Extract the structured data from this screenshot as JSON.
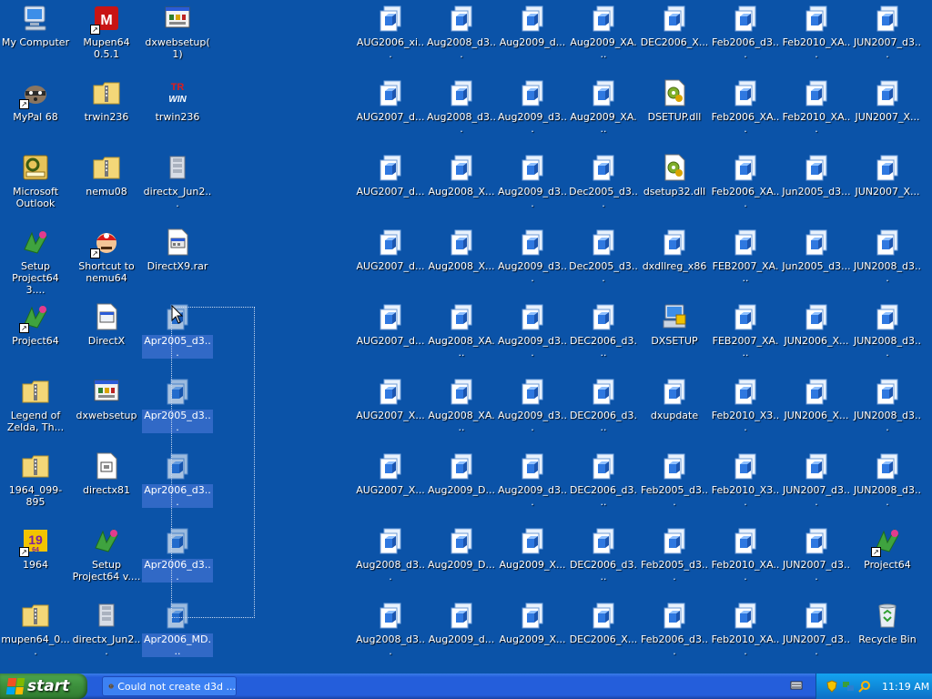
{
  "desktop": {
    "selection_color": "#3169c6",
    "icons": [
      {
        "label": "My Computer",
        "icon": "computer-icon",
        "col": 0,
        "row": 0
      },
      {
        "label": "Mupen64 0.5.1",
        "icon": "mupen64-icon",
        "col": 1,
        "row": 0,
        "shortcut": true
      },
      {
        "label": "dxwebsetup(1)",
        "icon": "installer-icon",
        "col": 2,
        "row": 0
      },
      {
        "label": "MyPal 68",
        "icon": "mypal-icon",
        "col": 0,
        "row": 1,
        "shortcut": true
      },
      {
        "label": "trwin236",
        "icon": "zip-folder-icon",
        "col": 1,
        "row": 1
      },
      {
        "label": "trwin236",
        "icon": "trwin-icon",
        "col": 2,
        "row": 1
      },
      {
        "label": "Microsoft Outlook",
        "icon": "outlook-icon",
        "col": 0,
        "row": 2
      },
      {
        "label": "nemu08",
        "icon": "zip-folder-icon",
        "col": 1,
        "row": 2
      },
      {
        "label": "directx_Jun2...",
        "icon": "archive-icon",
        "col": 2,
        "row": 2
      },
      {
        "label": "Setup Project64 3....",
        "icon": "setup-icon",
        "col": 0,
        "row": 3
      },
      {
        "label": "Shortcut to nemu64",
        "icon": "mario-icon",
        "col": 1,
        "row": 3,
        "shortcut": true
      },
      {
        "label": "DirectX9.rar",
        "icon": "rar-file-icon",
        "col": 2,
        "row": 3
      },
      {
        "label": "Project64",
        "icon": "setup-icon",
        "col": 0,
        "row": 4,
        "shortcut": true
      },
      {
        "label": "DirectX",
        "icon": "window-file-icon",
        "col": 1,
        "row": 4
      },
      {
        "label": "Apr2005_d3...",
        "icon": "cab-icon",
        "col": 2,
        "row": 4,
        "selected": true
      },
      {
        "label": "Legend of Zelda, Th...",
        "icon": "zip-folder-icon",
        "col": 0,
        "row": 5
      },
      {
        "label": "dxwebsetup",
        "icon": "installer-icon",
        "col": 1,
        "row": 5
      },
      {
        "label": "Apr2005_d3...",
        "icon": "cab-icon",
        "col": 2,
        "row": 5,
        "selected": true
      },
      {
        "label": "1964_099-895",
        "icon": "zip-folder-icon",
        "col": 0,
        "row": 6
      },
      {
        "label": "directx81",
        "icon": "doc-icon",
        "col": 1,
        "row": 6
      },
      {
        "label": "Apr2006_d3...",
        "icon": "cab-icon",
        "col": 2,
        "row": 6,
        "selected": true
      },
      {
        "label": "1964",
        "icon": "emu1964-icon",
        "col": 0,
        "row": 7,
        "shortcut": true
      },
      {
        "label": "Setup Project64 v....",
        "icon": "setup-icon",
        "col": 1,
        "row": 7
      },
      {
        "label": "Apr2006_d3...",
        "icon": "cab-icon",
        "col": 2,
        "row": 7,
        "selected": true
      },
      {
        "label": "mupen64_0....",
        "icon": "zip-folder-icon",
        "col": 0,
        "row": 8
      },
      {
        "label": "directx_Jun2...",
        "icon": "archive-icon",
        "col": 1,
        "row": 8
      },
      {
        "label": "Apr2006_MD...",
        "icon": "cab-icon",
        "col": 2,
        "row": 8,
        "selected": true
      },
      {
        "label": "AUG2006_xi...",
        "icon": "cab-icon",
        "col": 5,
        "row": 0
      },
      {
        "label": "AUG2007_d...",
        "icon": "cab-icon",
        "col": 5,
        "row": 1
      },
      {
        "label": "AUG2007_d...",
        "icon": "cab-icon",
        "col": 5,
        "row": 2
      },
      {
        "label": "AUG2007_d...",
        "icon": "cab-icon",
        "col": 5,
        "row": 3
      },
      {
        "label": "AUG2007_d...",
        "icon": "cab-icon",
        "col": 5,
        "row": 4
      },
      {
        "label": "AUG2007_X...",
        "icon": "cab-icon",
        "col": 5,
        "row": 5
      },
      {
        "label": "AUG2007_X...",
        "icon": "cab-icon",
        "col": 5,
        "row": 6
      },
      {
        "label": "Aug2008_d3...",
        "icon": "cab-icon",
        "col": 5,
        "row": 7
      },
      {
        "label": "Aug2008_d3...",
        "icon": "cab-icon",
        "col": 5,
        "row": 8
      },
      {
        "label": "Aug2008_d3...",
        "icon": "cab-icon",
        "col": 6,
        "row": 0
      },
      {
        "label": "Aug2008_d3...",
        "icon": "cab-icon",
        "col": 6,
        "row": 1
      },
      {
        "label": "Aug2008_X...",
        "icon": "cab-icon",
        "col": 6,
        "row": 2
      },
      {
        "label": "Aug2008_X...",
        "icon": "cab-icon",
        "col": 6,
        "row": 3
      },
      {
        "label": "Aug2008_XA...",
        "icon": "cab-icon",
        "col": 6,
        "row": 4
      },
      {
        "label": "Aug2008_XA...",
        "icon": "cab-icon",
        "col": 6,
        "row": 5
      },
      {
        "label": "Aug2009_D...",
        "icon": "cab-icon",
        "col": 6,
        "row": 6
      },
      {
        "label": "Aug2009_D...",
        "icon": "cab-icon",
        "col": 6,
        "row": 7
      },
      {
        "label": "Aug2009_d...",
        "icon": "cab-icon",
        "col": 6,
        "row": 8
      },
      {
        "label": "Aug2009_d...",
        "icon": "cab-icon",
        "col": 7,
        "row": 0
      },
      {
        "label": "Aug2009_d3...",
        "icon": "cab-icon",
        "col": 7,
        "row": 1
      },
      {
        "label": "Aug2009_d3...",
        "icon": "cab-icon",
        "col": 7,
        "row": 2
      },
      {
        "label": "Aug2009_d3...",
        "icon": "cab-icon",
        "col": 7,
        "row": 3
      },
      {
        "label": "Aug2009_d3...",
        "icon": "cab-icon",
        "col": 7,
        "row": 4
      },
      {
        "label": "Aug2009_d3...",
        "icon": "cab-icon",
        "col": 7,
        "row": 5
      },
      {
        "label": "Aug2009_d3...",
        "icon": "cab-icon",
        "col": 7,
        "row": 6
      },
      {
        "label": "Aug2009_X...",
        "icon": "cab-icon",
        "col": 7,
        "row": 7
      },
      {
        "label": "Aug2009_X...",
        "icon": "cab-icon",
        "col": 7,
        "row": 8
      },
      {
        "label": "Aug2009_XA...",
        "icon": "cab-icon",
        "col": 8,
        "row": 0
      },
      {
        "label": "Aug2009_XA...",
        "icon": "cab-icon",
        "col": 8,
        "row": 1
      },
      {
        "label": "Dec2005_d3...",
        "icon": "cab-icon",
        "col": 8,
        "row": 2
      },
      {
        "label": "Dec2005_d3...",
        "icon": "cab-icon",
        "col": 8,
        "row": 3
      },
      {
        "label": "DEC2006_d3...",
        "icon": "cab-icon",
        "col": 8,
        "row": 4
      },
      {
        "label": "DEC2006_d3...",
        "icon": "cab-icon",
        "col": 8,
        "row": 5
      },
      {
        "label": "DEC2006_d3...",
        "icon": "cab-icon",
        "col": 8,
        "row": 6
      },
      {
        "label": "DEC2006_d3...",
        "icon": "cab-icon",
        "col": 8,
        "row": 7
      },
      {
        "label": "DEC2006_X...",
        "icon": "cab-icon",
        "col": 8,
        "row": 8
      },
      {
        "label": "DEC2006_X...",
        "icon": "cab-icon",
        "col": 9,
        "row": 0
      },
      {
        "label": "DSETUP.dll",
        "icon": "dll-icon",
        "col": 9,
        "row": 1
      },
      {
        "label": "dsetup32.dll",
        "icon": "dll-icon",
        "col": 9,
        "row": 2
      },
      {
        "label": "dxdllreg_x86",
        "icon": "cab-icon",
        "col": 9,
        "row": 3
      },
      {
        "label": "DXSETUP",
        "icon": "dxsetup-icon",
        "col": 9,
        "row": 4
      },
      {
        "label": "dxupdate",
        "icon": "cab-icon",
        "col": 9,
        "row": 5
      },
      {
        "label": "Feb2005_d3...",
        "icon": "cab-icon",
        "col": 9,
        "row": 6
      },
      {
        "label": "Feb2005_d3...",
        "icon": "cab-icon",
        "col": 9,
        "row": 7
      },
      {
        "label": "Feb2006_d3...",
        "icon": "cab-icon",
        "col": 9,
        "row": 8
      },
      {
        "label": "Feb2006_d3...",
        "icon": "cab-icon",
        "col": 10,
        "row": 0
      },
      {
        "label": "Feb2006_XA...",
        "icon": "cab-icon",
        "col": 10,
        "row": 1
      },
      {
        "label": "Feb2006_XA...",
        "icon": "cab-icon",
        "col": 10,
        "row": 2
      },
      {
        "label": "FEB2007_XA...",
        "icon": "cab-icon",
        "col": 10,
        "row": 3
      },
      {
        "label": "FEB2007_XA...",
        "icon": "cab-icon",
        "col": 10,
        "row": 4
      },
      {
        "label": "Feb2010_X3...",
        "icon": "cab-icon",
        "col": 10,
        "row": 5
      },
      {
        "label": "Feb2010_X3...",
        "icon": "cab-icon",
        "col": 10,
        "row": 6
      },
      {
        "label": "Feb2010_XA...",
        "icon": "cab-icon",
        "col": 10,
        "row": 7
      },
      {
        "label": "Feb2010_XA...",
        "icon": "cab-icon",
        "col": 10,
        "row": 8
      },
      {
        "label": "Feb2010_XA...",
        "icon": "cab-icon",
        "col": 11,
        "row": 0
      },
      {
        "label": "Feb2010_XA...",
        "icon": "cab-icon",
        "col": 11,
        "row": 1
      },
      {
        "label": "Jun2005_d3...",
        "icon": "cab-icon",
        "col": 11,
        "row": 2
      },
      {
        "label": "Jun2005_d3...",
        "icon": "cab-icon",
        "col": 11,
        "row": 3
      },
      {
        "label": "JUN2006_X...",
        "icon": "cab-icon",
        "col": 11,
        "row": 4
      },
      {
        "label": "JUN2006_X...",
        "icon": "cab-icon",
        "col": 11,
        "row": 5
      },
      {
        "label": "JUN2007_d3...",
        "icon": "cab-icon",
        "col": 11,
        "row": 6
      },
      {
        "label": "JUN2007_d3...",
        "icon": "cab-icon",
        "col": 11,
        "row": 7
      },
      {
        "label": "JUN2007_d3...",
        "icon": "cab-icon",
        "col": 11,
        "row": 8
      },
      {
        "label": "JUN2007_d3...",
        "icon": "cab-icon",
        "col": 12,
        "row": 0
      },
      {
        "label": "JUN2007_X...",
        "icon": "cab-icon",
        "col": 12,
        "row": 1
      },
      {
        "label": "JUN2007_X...",
        "icon": "cab-icon",
        "col": 12,
        "row": 2
      },
      {
        "label": "JUN2008_d3...",
        "icon": "cab-icon",
        "col": 12,
        "row": 3
      },
      {
        "label": "JUN2008_d3...",
        "icon": "cab-icon",
        "col": 12,
        "row": 4
      },
      {
        "label": "JUN2008_d3...",
        "icon": "cab-icon",
        "col": 12,
        "row": 5
      },
      {
        "label": "JUN2008_d3...",
        "icon": "cab-icon",
        "col": 12,
        "row": 6
      },
      {
        "label": "Project64",
        "icon": "setup-icon",
        "col": 12,
        "row": 7,
        "shortcut": true
      },
      {
        "label": "Recycle Bin",
        "icon": "recycle-bin-icon",
        "col": 12,
        "row": 8
      }
    ]
  },
  "taskbar": {
    "start_label": "start",
    "task_item_label": "Could not create d3d ...",
    "clock": "11:19 AM"
  }
}
